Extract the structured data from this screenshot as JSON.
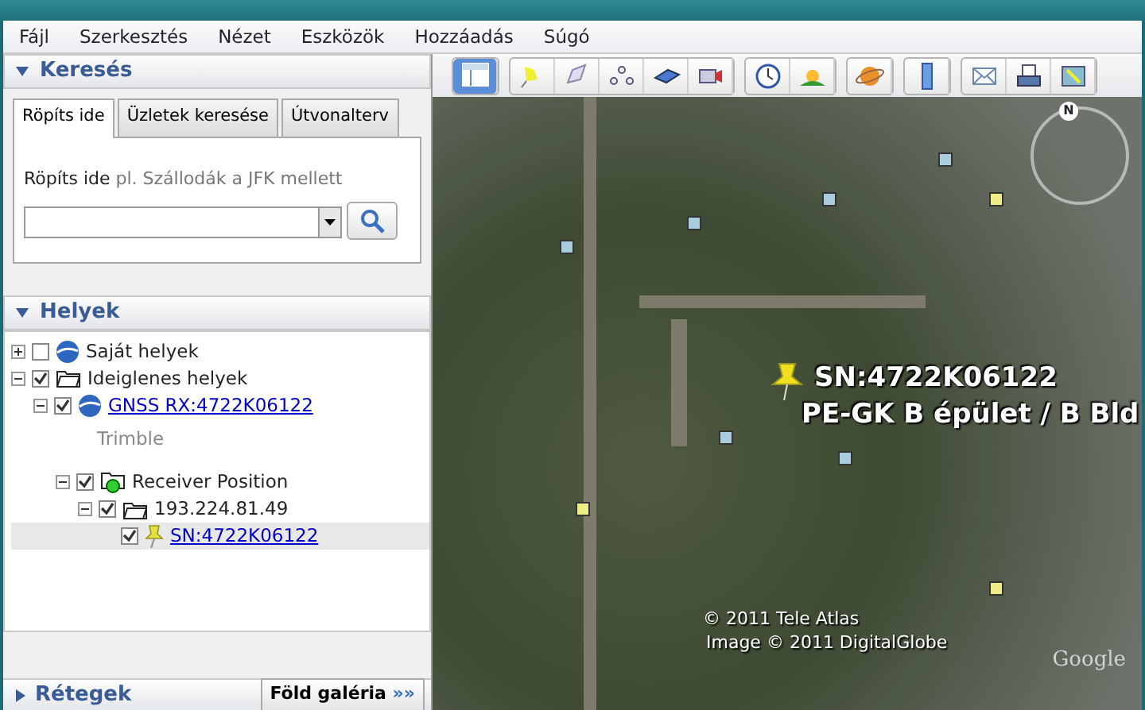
{
  "menu": [
    "Fájl",
    "Szerkesztés",
    "Nézet",
    "Eszközök",
    "Hozzáadás",
    "Súgó"
  ],
  "search_panel": {
    "title": "Keresés",
    "expanded": true,
    "tabs": [
      {
        "label": "Röpíts ide",
        "selected": true
      },
      {
        "label": "Üzletek keresése",
        "selected": false
      },
      {
        "label": "Útvonalterv",
        "selected": false
      }
    ],
    "label": "Röpíts ide",
    "hint": "pl. Szállodák a JFK mellett"
  },
  "places_panel": {
    "title": "Helyek",
    "expanded": true,
    "tree": [
      {
        "label": "Saját helyek",
        "kind": "globe",
        "checked": false,
        "expanded": false,
        "link": false,
        "selected": false
      },
      {
        "label": "Ideiglenes helyek",
        "kind": "folder",
        "checked": true,
        "expanded": true,
        "link": false,
        "selected": false,
        "children": [
          {
            "label": "GNSS RX:4722K06122",
            "kind": "globe",
            "checked": true,
            "expanded": true,
            "link": true,
            "selected": false,
            "description": "Trimble",
            "children": [
              {
                "label": "Receiver Position",
                "kind": "receiver",
                "checked": true,
                "expanded": true,
                "link": false,
                "selected": false,
                "children": [
                  {
                    "label": "193.224.81.49",
                    "kind": "folder",
                    "checked": true,
                    "expanded": true,
                    "link": false,
                    "selected": false,
                    "children": [
                      {
                        "label": "SN:4722K06122",
                        "kind": "pin",
                        "checked": true,
                        "link": true,
                        "selected": true
                      }
                    ]
                  }
                ]
              }
            ]
          }
        ]
      }
    ]
  },
  "layers_panel": {
    "title": "Rétegek",
    "expanded": false,
    "button": {
      "label": "Föld galéria",
      "arrow": "»»"
    }
  },
  "toolbar": [
    {
      "kind": "sidebar",
      "selected": true
    },
    {
      "kind": "placemark"
    },
    {
      "kind": "polygon"
    },
    {
      "kind": "path"
    },
    {
      "kind": "overlay"
    },
    {
      "kind": "tour"
    },
    {
      "kind": "clock"
    },
    {
      "kind": "sun"
    },
    {
      "kind": "planet"
    },
    {
      "kind": "ruler"
    },
    {
      "kind": "email"
    },
    {
      "kind": "print"
    },
    {
      "kind": "maps"
    }
  ],
  "map": {
    "labels": [
      {
        "kind": "placemark",
        "text": "SN:4722K06122"
      },
      {
        "kind": "building",
        "text": "PE-GK B épület / B Bld"
      }
    ],
    "attribution": [
      "© 2011 Tele Atlas",
      "Image © 2011 DigitalGlobe"
    ],
    "logo": "Google",
    "compass": "N"
  }
}
